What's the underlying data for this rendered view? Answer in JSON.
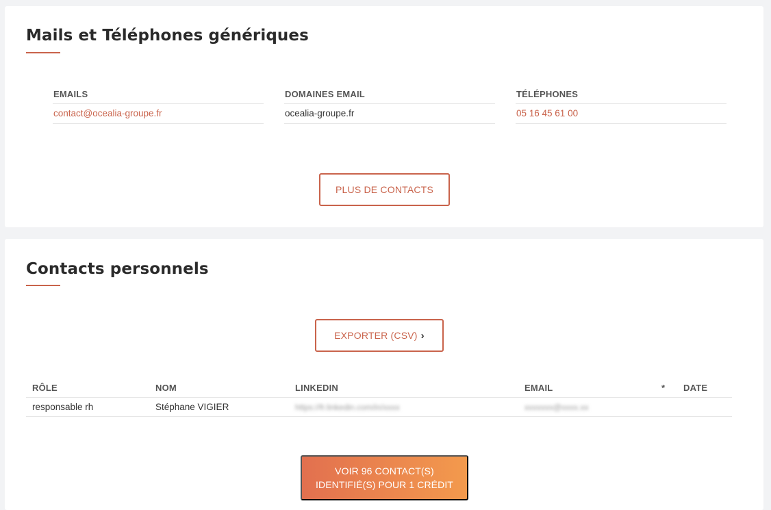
{
  "generic": {
    "title": "Mails et Téléphones génériques",
    "columns": [
      {
        "header": "EMAILS",
        "value": "contact@ocealia-groupe.fr"
      },
      {
        "header": "DOMAINES EMAIL",
        "value": "ocealia-groupe.fr"
      },
      {
        "header": "TÉLÉPHONES",
        "value": "05 16 45 61 00"
      }
    ],
    "more_button": "PLUS DE CONTACTS"
  },
  "personal": {
    "title": "Contacts personnels",
    "export_button": "EXPORTER (CSV)",
    "export_chevron": "›",
    "table": {
      "headers": [
        "RÔLE",
        "NOM",
        "LINKEDIN",
        "EMAIL",
        "*",
        "DATE"
      ],
      "rows": [
        [
          "responsable rh",
          "Stéphane VIGIER",
          "https://fr.linkedin.com/in/xxxx",
          "xxxxxxx@xxxx.xx",
          "",
          ""
        ]
      ]
    },
    "cta_line1": "VOIR 96 CONTACT(S)",
    "cta_line2": "IDENTIFIÉ(S) POUR 1 CRÉDIT"
  },
  "colors": {
    "accent": "#c9634b",
    "cta_start": "#e2704f",
    "cta_end": "#f39a4d",
    "background": "#f2f3f5"
  }
}
